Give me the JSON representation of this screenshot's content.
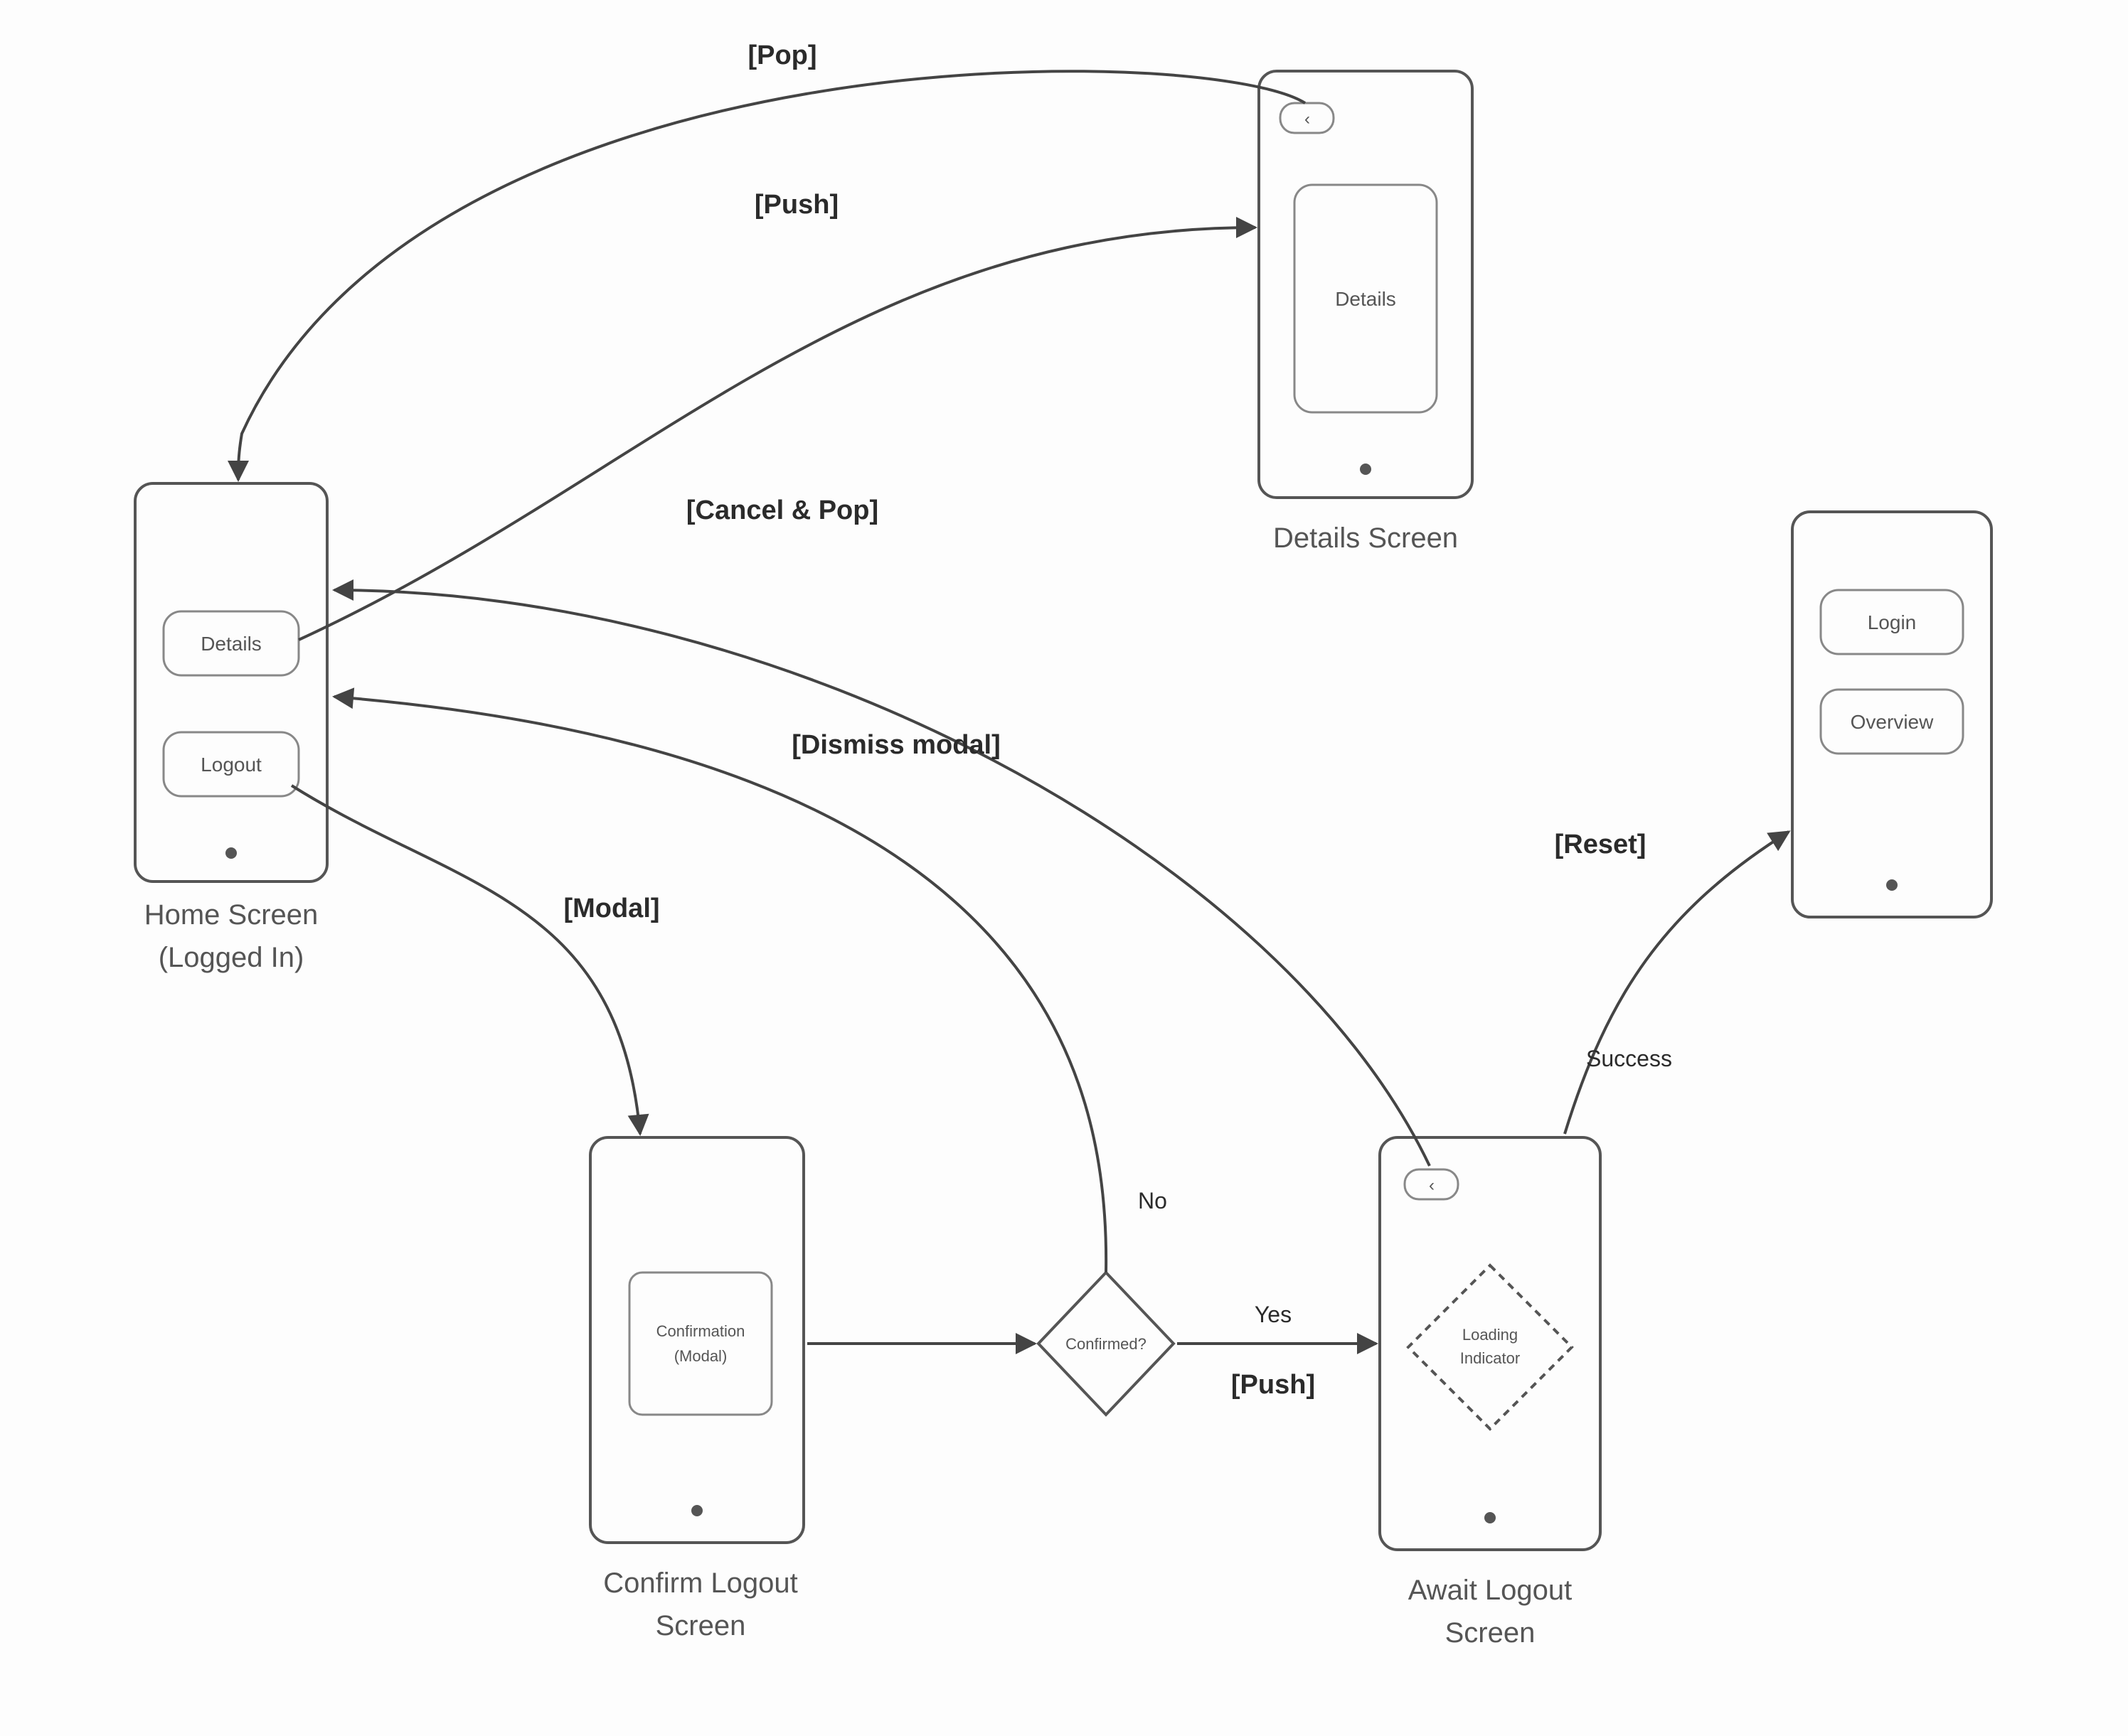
{
  "screens": {
    "home": {
      "title_line1": "Home Screen",
      "title_line2": "(Logged In)",
      "buttons": {
        "details": "Details",
        "logout": "Logout"
      }
    },
    "details": {
      "title": "Details Screen",
      "content": "Details"
    },
    "confirm": {
      "title_line1": "Confirm Logout",
      "title_line2": "Screen",
      "modal_line1": "Confirmation",
      "modal_line2": "(Modal)"
    },
    "await": {
      "title_line1": "Await Logout",
      "title_line2": "Screen",
      "indicator_line1": "Loading",
      "indicator_line2": "Indicator"
    },
    "login": {
      "buttons": {
        "login": "Login",
        "overview": "Overview"
      }
    }
  },
  "decision": {
    "label": "Confirmed?"
  },
  "edges": {
    "pop": "[Pop]",
    "push_details": "[Push]",
    "cancel_pop": "[Cancel & Pop]",
    "dismiss_modal": "[Dismiss modal]",
    "modal": "[Modal]",
    "reset": "[Reset]",
    "no": "No",
    "yes": "Yes",
    "push_await": "[Push]",
    "success": "Success"
  }
}
